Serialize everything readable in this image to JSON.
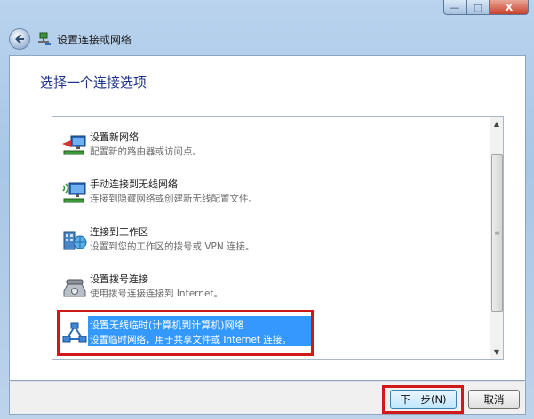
{
  "window": {
    "title": "设置连接或网络",
    "controls": {
      "minimize": "—",
      "maximize": "□",
      "close": "X"
    }
  },
  "main": {
    "heading": "选择一个连接选项"
  },
  "options": [
    {
      "title": "设置新网络",
      "desc": "配置新的路由器或访问点。",
      "icon": "router-network-icon",
      "selected": false
    },
    {
      "title": "手动连接到无线网络",
      "desc": "连接到隐藏网络或创建新无线配置文件。",
      "icon": "wireless-monitor-icon",
      "selected": false
    },
    {
      "title": "连接到工作区",
      "desc": "设置到您的工作区的拨号或 VPN 连接。",
      "icon": "workplace-globe-icon",
      "selected": false
    },
    {
      "title": "设置拨号连接",
      "desc": "使用拨号连接连接到 Internet。",
      "icon": "dialup-phone-icon",
      "selected": false
    },
    {
      "title": "设置无线临时(计算机到计算机)网络",
      "desc": "设置临时网络，用于共享文件或 Internet 连接。",
      "icon": "adhoc-network-icon",
      "selected": true
    }
  ],
  "scrollbar": {
    "grip": "≡"
  },
  "footer": {
    "next_label": "下一步(N)",
    "cancel_label": "取消"
  },
  "colors": {
    "selection": "#3399ff",
    "highlight_box": "#d11919",
    "heading": "#1e3287"
  }
}
